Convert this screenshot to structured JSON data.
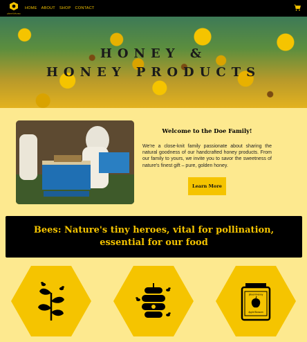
{
  "nav": {
    "logo_text": "pibeeYoHoney",
    "links": [
      "HOME",
      "ABOUT",
      "SHOP",
      "CONTACT"
    ],
    "cart_icon": "cart-icon"
  },
  "hero": {
    "line1": "HONEY &",
    "line2": "HONEY PRODUCTS"
  },
  "welcome": {
    "title": "Welcome to the Doe Family!",
    "text": "We're a close-knit family passionate about sharing the natural goodness of our handcrafted honey products. From our family to yours, we invite you to savor the sweetness of nature's finest gift – pure, golden honey.",
    "button": "Learn More"
  },
  "banner": {
    "text": "Bees: Nature's tiny heroes, vital for pollination, essential for our food"
  },
  "features": [
    {
      "icon": "plant-with-bees-icon"
    },
    {
      "icon": "beehive-icon"
    },
    {
      "icon": "honey-jar-icon",
      "jar_label_top": "pibeeYoHoney",
      "jar_label_bottom": "Apple Blossom"
    }
  ],
  "colors": {
    "accent": "#f5c400",
    "background": "#fde98f",
    "dark": "#000000"
  }
}
